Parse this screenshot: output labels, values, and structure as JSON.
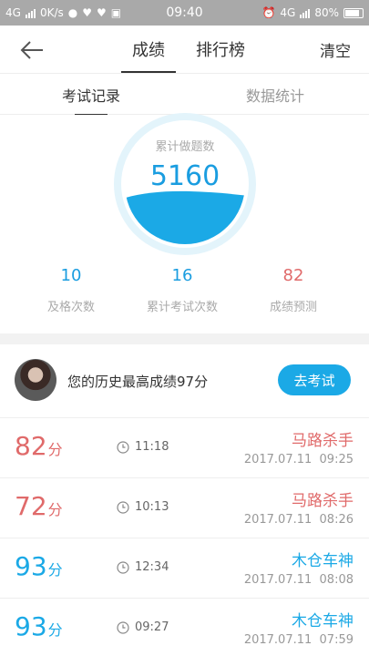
{
  "status_bar": {
    "network_left": "4G",
    "speed": "0K/s",
    "time": "09:40",
    "network_right": "4G",
    "battery": "80%"
  },
  "header": {
    "tabs": [
      {
        "label": "成绩",
        "active": true
      },
      {
        "label": "排行榜",
        "active": false
      }
    ],
    "clear_label": "清空"
  },
  "subtabs": [
    {
      "label": "考试记录",
      "active": true
    },
    {
      "label": "数据统计",
      "active": false
    }
  ],
  "stats": {
    "gauge_label": "累计做题数",
    "gauge_value": "5160",
    "items": [
      {
        "value": "10",
        "label": "及格次数",
        "color": "#1a9de0"
      },
      {
        "value": "16",
        "label": "累计考试次数",
        "color": "#1a9de0"
      },
      {
        "value": "82",
        "label": "成绩预测",
        "color": "#e06a6a"
      }
    ]
  },
  "best": {
    "text": "您的历史最高成绩97分",
    "button_label": "去考试"
  },
  "records": [
    {
      "score": "82",
      "unit": "分",
      "duration": "11:18",
      "title": "马路杀手",
      "date": "2017.07.11  09:25",
      "color": "#e06a6a"
    },
    {
      "score": "72",
      "unit": "分",
      "duration": "10:13",
      "title": "马路杀手",
      "date": "2017.07.11  08:26",
      "color": "#e06a6a"
    },
    {
      "score": "93",
      "unit": "分",
      "duration": "12:34",
      "title": "木仓车神",
      "date": "2017.07.11  08:08",
      "color": "#1ba9e6"
    },
    {
      "score": "93",
      "unit": "分",
      "duration": "09:27",
      "title": "木仓车神",
      "date": "2017.07.11  07:59",
      "color": "#1ba9e6"
    }
  ],
  "colors": {
    "accent_blue": "#1ba9e6",
    "score_red": "#e06a6a"
  }
}
